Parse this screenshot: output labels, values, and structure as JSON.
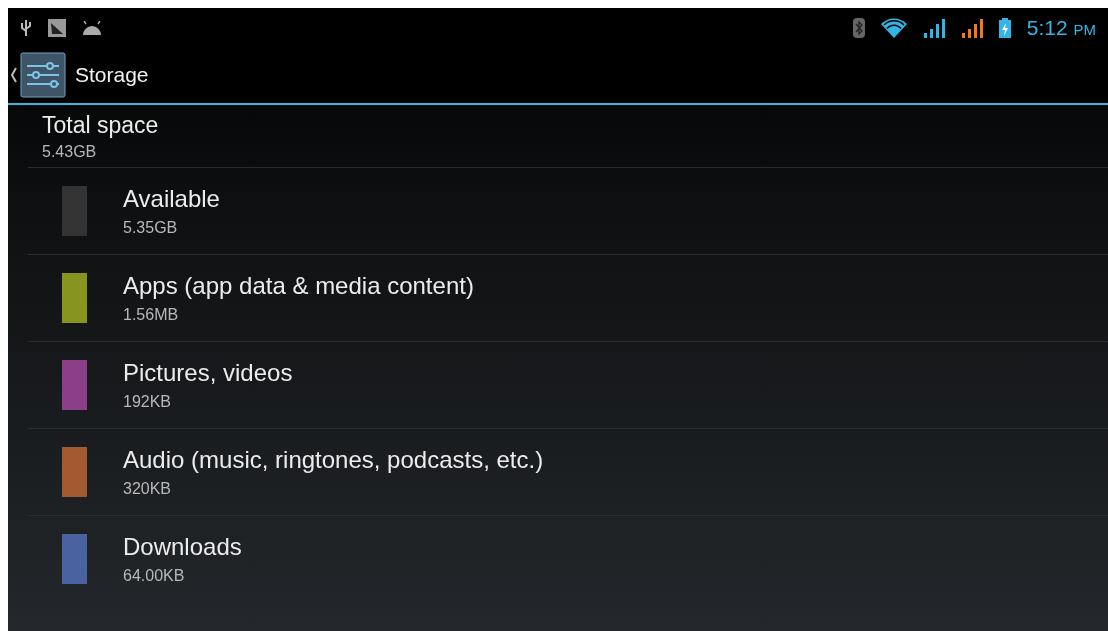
{
  "status_bar": {
    "time": "5:12",
    "time_suffix": "PM"
  },
  "action_bar": {
    "title": "Storage"
  },
  "total": {
    "label": "Total space",
    "value": "5.43GB"
  },
  "items": [
    {
      "name": "Available",
      "size": "5.35GB",
      "color": "#333333"
    },
    {
      "name": "Apps (app data & media content)",
      "size": "1.56MB",
      "color": "#87941f"
    },
    {
      "name": "Pictures, videos",
      "size": "192KB",
      "color": "#8a3f88"
    },
    {
      "name": "Audio (music, ringtones, podcasts, etc.)",
      "size": "320KB",
      "color": "#a45a30"
    },
    {
      "name": "Downloads",
      "size": "64.00KB",
      "color": "#4a62a0"
    }
  ]
}
